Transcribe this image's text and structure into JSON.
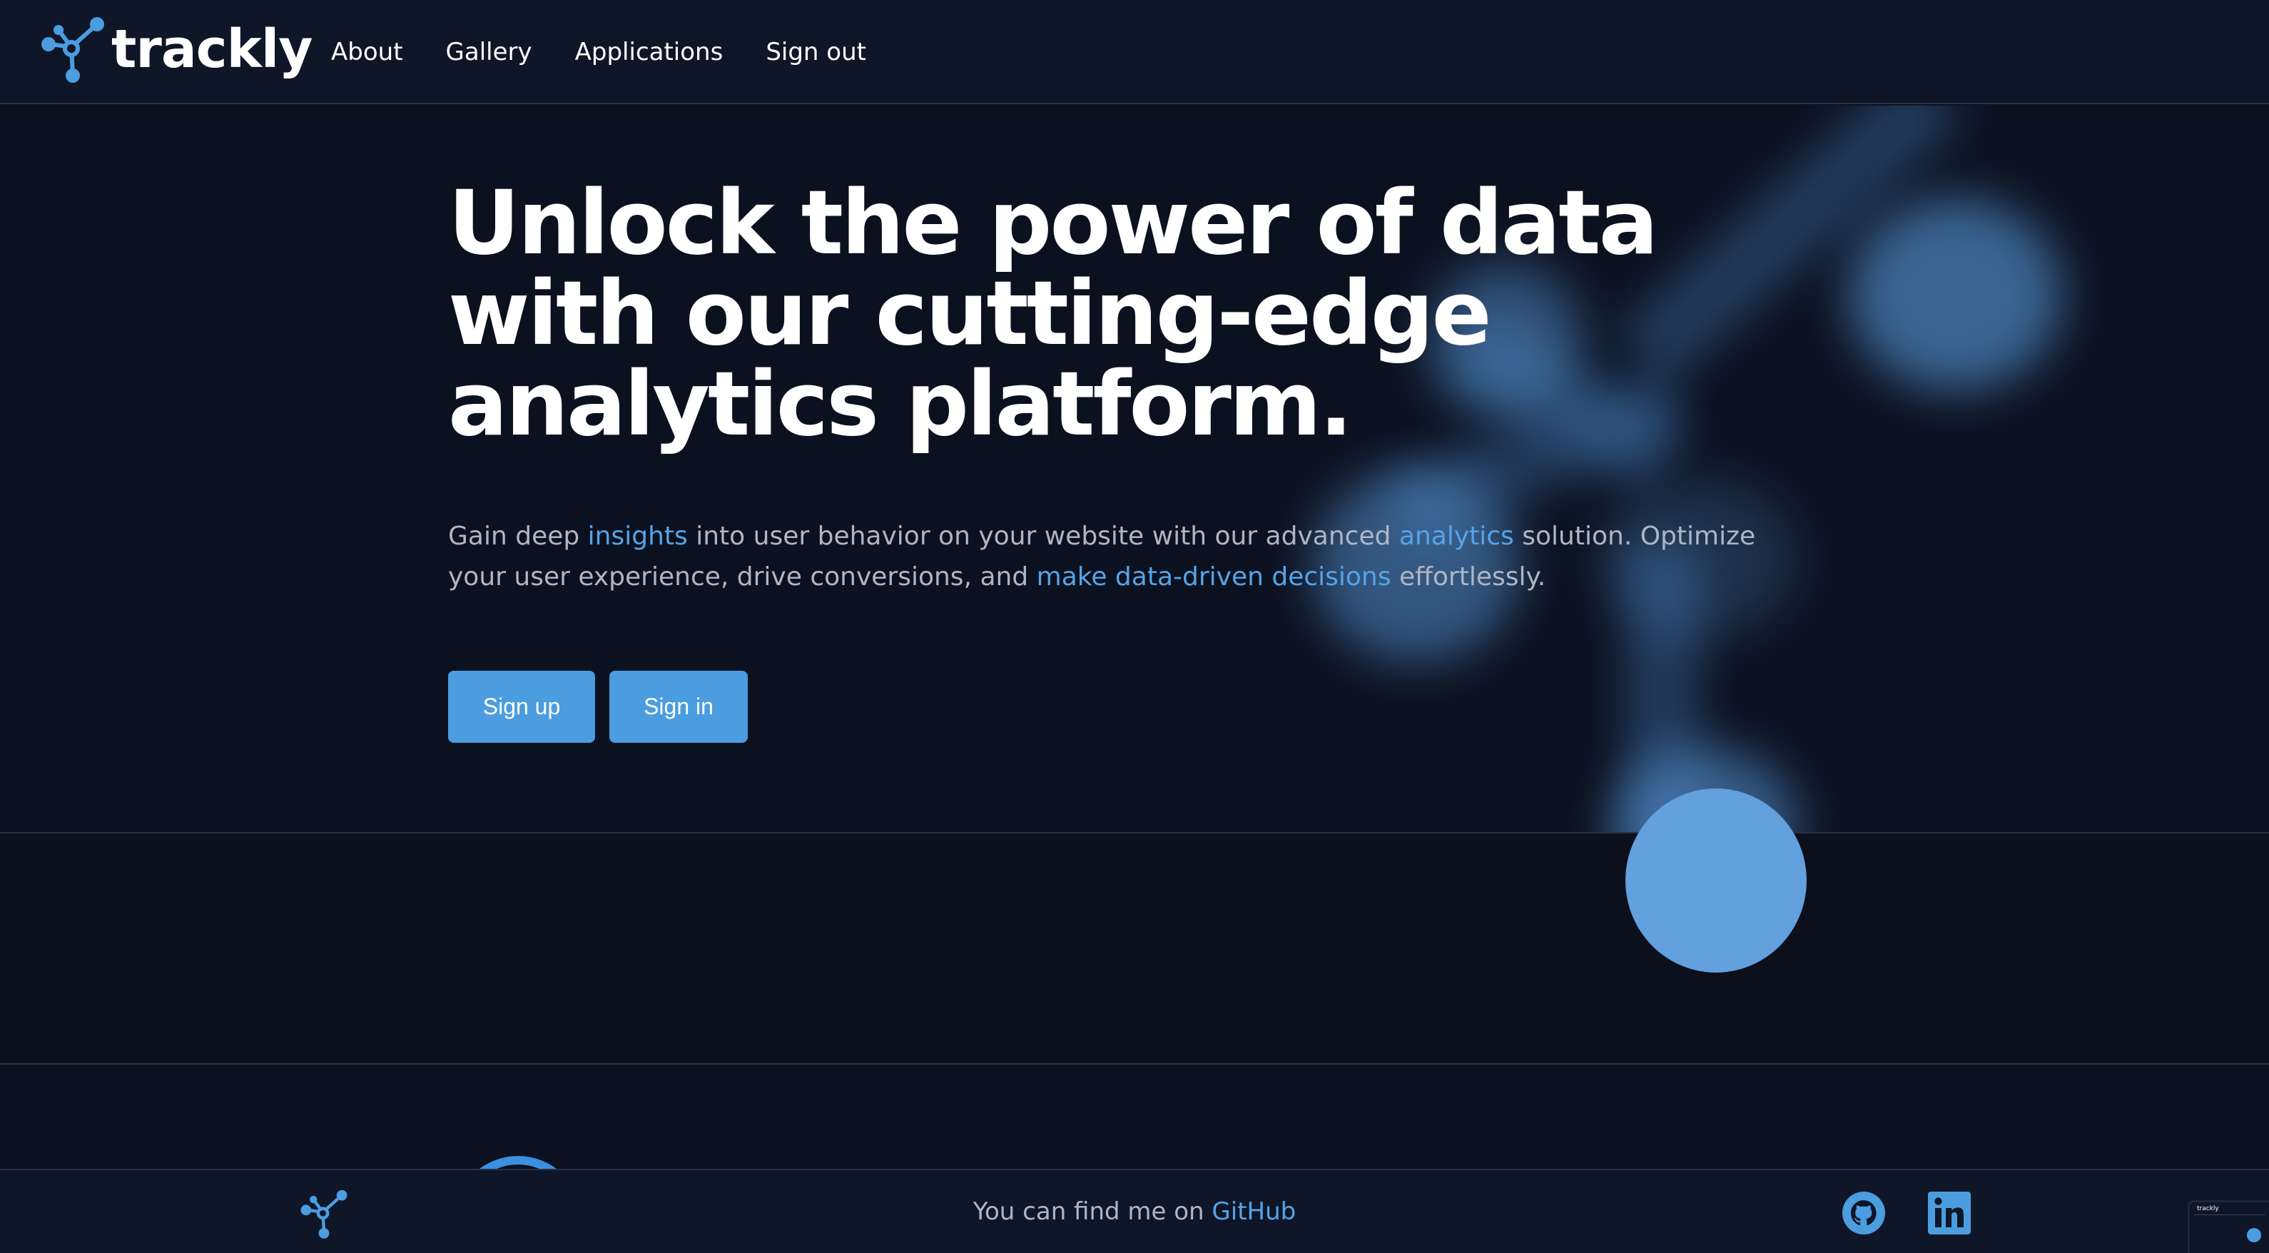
{
  "brand": {
    "name": "trackly",
    "logo_icon": "molecule-network-icon"
  },
  "nav": {
    "items": [
      {
        "label": "About"
      },
      {
        "label": "Gallery"
      },
      {
        "label": "Applications"
      },
      {
        "label": "Sign out"
      }
    ]
  },
  "hero": {
    "headline": "Unlock the power of data with our cutting-edge analytics platform.",
    "subtext": {
      "p1": "Gain deep ",
      "hl1": "insights",
      "p2": " into user behavior on your website with our advanced ",
      "hl2": "analytics",
      "p3": " solution. Optimize your user experience, drive conversions, and ",
      "hl3": "make data-driven decisions",
      "p4": " effortlessly."
    },
    "buttons": {
      "signup": "Sign up",
      "signin": "Sign in"
    }
  },
  "footer": {
    "text_prefix": "You can find me on ",
    "link": "GitHub",
    "logo_icon": "molecule-network-icon",
    "social_icons": [
      "github-icon",
      "linkedin-icon"
    ]
  },
  "thumbnail": {
    "text": "trackly"
  },
  "colors": {
    "background": "#0c1120",
    "navbar": "#0f1628",
    "accent": "#4b9de0",
    "link": "#56a4e8",
    "muted_text": "#aeb6c6",
    "divider": "#2a3144"
  }
}
